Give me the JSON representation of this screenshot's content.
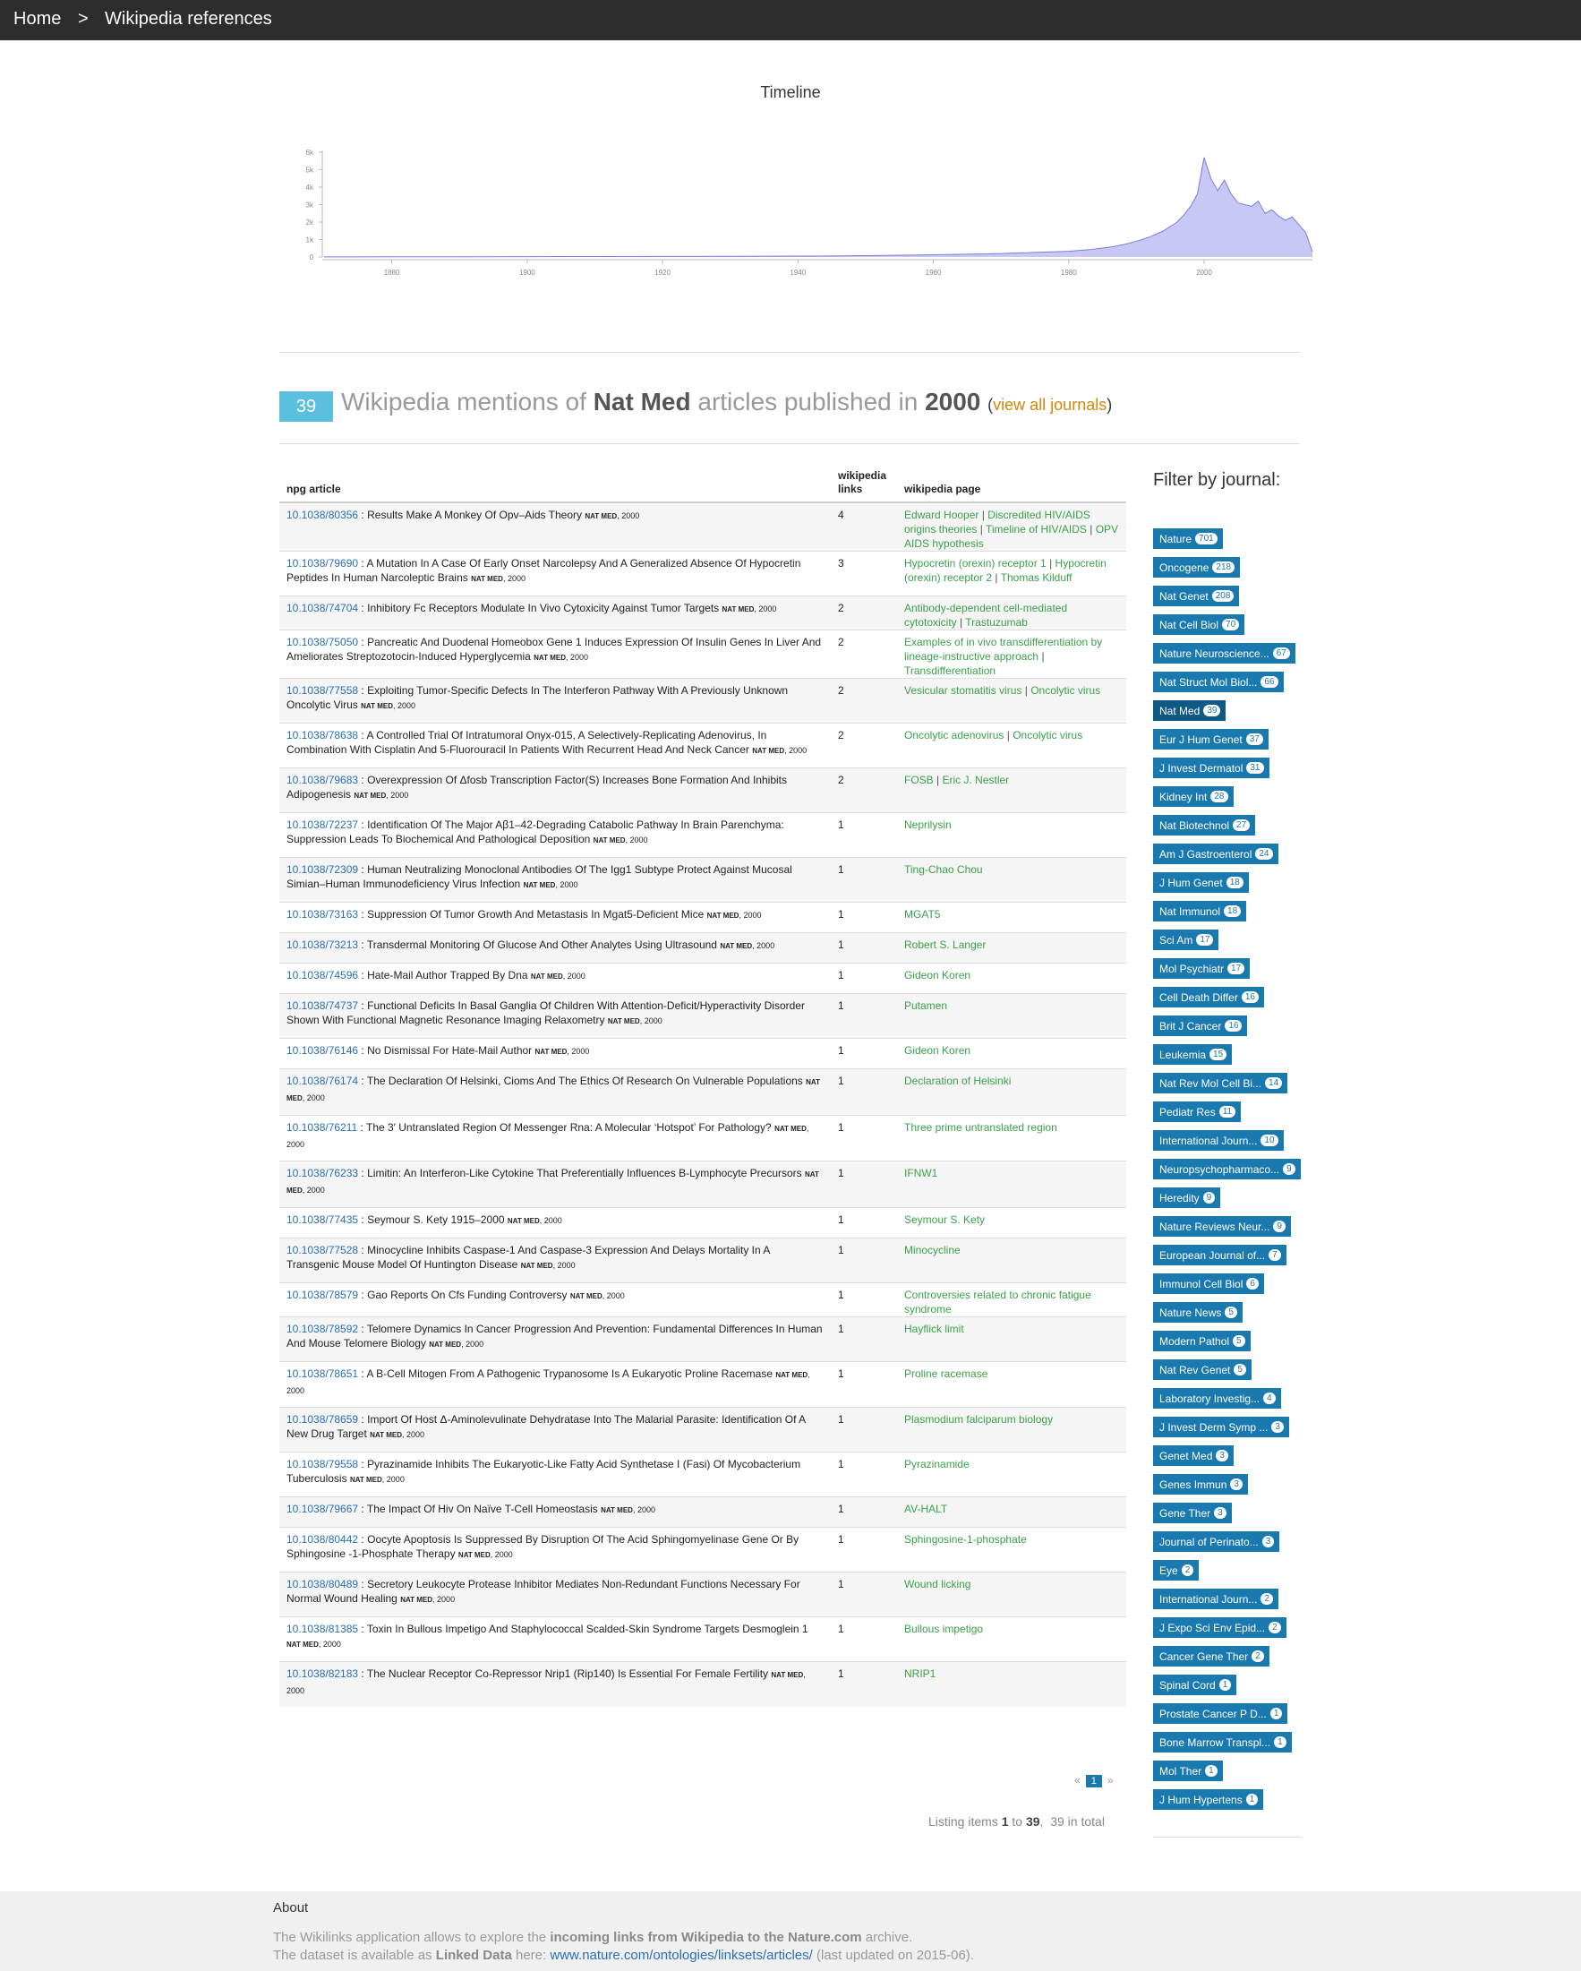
{
  "breadcrumb": {
    "home": "Home",
    "separator": ">",
    "current": "Wikipedia references"
  },
  "timeline": {
    "title": "Timeline"
  },
  "chart_data": {
    "type": "area",
    "title": "Timeline",
    "xlabel": "",
    "ylabel": "",
    "xlim": [
      1870,
      2016
    ],
    "ylim": [
      0,
      6000
    ],
    "y_ticks": [
      "0",
      "1k",
      "2k",
      "3k",
      "4k",
      "5k",
      "6k"
    ],
    "x_ticks": [
      "1880",
      "1900",
      "1920",
      "1940",
      "1960",
      "1980",
      "2000"
    ],
    "colors": {
      "fill": "#c8c8f5",
      "stroke": "#7b7be0"
    },
    "series": [
      {
        "x": [
          1870,
          1880,
          1890,
          1900,
          1910,
          1920,
          1930,
          1940,
          1945,
          1950,
          1955,
          1960,
          1965,
          1970,
          1975,
          1980,
          1983,
          1986,
          1988,
          1990,
          1992,
          1994,
          1996,
          1997,
          1998,
          1999,
          2000,
          2001,
          2002,
          2003,
          2004,
          2005,
          2006,
          2007,
          2008,
          2009,
          2010,
          2011,
          2012,
          2013,
          2014,
          2015,
          2016
        ],
        "y": [
          5,
          10,
          15,
          20,
          25,
          30,
          40,
          50,
          60,
          80,
          100,
          130,
          160,
          200,
          260,
          330,
          420,
          560,
          700,
          900,
          1150,
          1500,
          2000,
          2400,
          2900,
          3600,
          5700,
          4500,
          3800,
          4400,
          3600,
          3100,
          3000,
          2900,
          3200,
          2500,
          2700,
          2350,
          2100,
          2300,
          1850,
          1400,
          300
        ]
      }
    ]
  },
  "heading": {
    "count": "39",
    "prefix": "Wikipedia mentions of",
    "journal": "Nat Med",
    "middle": "articles published in",
    "year": "2000",
    "open": "(",
    "link": "view all journals",
    "close": ")"
  },
  "table": {
    "headers": {
      "article": "npg article",
      "links_line1": "wikipedia",
      "links_line2": "links",
      "page": "wikipedia page"
    },
    "rows": [
      {
        "doi": "10.1038/80356",
        "title": "Results Make A Monkey Of Opv–Aids Theory",
        "journal": "NAT MED",
        "year": ", 2000",
        "links": "4",
        "pages": [
          "Edward Hooper",
          "Discredited HIV/AIDS origins theories",
          "Timeline of HIV/AIDS",
          "OPV AIDS hypothesis"
        ]
      },
      {
        "doi": "10.1038/79690",
        "title": "A Mutation In A Case Of Early Onset Narcolepsy And A Generalized Absence Of Hypocretin Peptides In Human Narcoleptic Brains",
        "journal": "NAT MED",
        "year": ", 2000",
        "links": "3",
        "pages": [
          "Hypocretin (orexin) receptor 1",
          "Hypocretin (orexin) receptor 2",
          "Thomas Kilduff"
        ]
      },
      {
        "doi": "10.1038/74704",
        "title": "Inhibitory Fc Receptors Modulate In Vivo Cytoxicity Against Tumor Targets",
        "journal": "NAT MED",
        "year": ", 2000",
        "links": "2",
        "pages": [
          "Antibody-dependent cell-mediated cytotoxicity",
          "Trastuzumab"
        ]
      },
      {
        "doi": "10.1038/75050",
        "title": "Pancreatic And Duodenal Homeobox Gene 1 Induces Expression Of Insulin Genes In Liver And Ameliorates Streptozotocin-Induced Hyperglycemia",
        "journal": "NAT MED",
        "year": ", 2000",
        "links": "2",
        "pages": [
          "Examples of in vivo transdifferentiation by lineage-instructive approach",
          "Transdifferentiation"
        ]
      },
      {
        "doi": "10.1038/77558",
        "title": "Exploiting Tumor-Specific Defects In The Interferon Pathway With A Previously Unknown Oncolytic Virus",
        "journal": "NAT MED",
        "year": ", 2000",
        "links": "2",
        "pages": [
          "Vesicular stomatitis virus",
          "Oncolytic virus"
        ]
      },
      {
        "doi": "10.1038/78638",
        "title": "A Controlled Trial Of Intratumoral Onyx-015, A Selectively-Replicating Adenovirus, In Combination With Cisplatin And 5-Fluorouracil In Patients With Recurrent Head And Neck Cancer",
        "journal": "NAT MED",
        "year": ", 2000",
        "links": "2",
        "pages": [
          "Oncolytic adenovirus",
          "Oncolytic virus"
        ]
      },
      {
        "doi": "10.1038/79683",
        "title": "Overexpression Of Δfosb Transcription Factor(S) Increases Bone Formation And Inhibits Adipogenesis",
        "journal": "NAT MED",
        "year": ", 2000",
        "links": "2",
        "pages": [
          "FOSB",
          "Eric J. Nestler"
        ]
      },
      {
        "doi": "10.1038/72237",
        "title": "Identification Of The Major Aβ1–42-Degrading Catabolic Pathway In Brain Parenchyma: Suppression Leads To Biochemical And Pathological Deposition",
        "journal": "NAT MED",
        "year": ", 2000",
        "links": "1",
        "pages": [
          "Neprilysin"
        ]
      },
      {
        "doi": "10.1038/72309",
        "title": "Human Neutralizing Monoclonal Antibodies Of The Igg1 Subtype Protect Against Mucosal Simian–Human Immunodeficiency Virus Infection",
        "journal": "NAT MED",
        "year": ", 2000",
        "links": "1",
        "pages": [
          "Ting-Chao Chou"
        ]
      },
      {
        "doi": "10.1038/73163",
        "title": "Suppression Of Tumor Growth And Metastasis In Mgat5-Deficient Mice",
        "journal": "NAT MED",
        "year": ", 2000",
        "links": "1",
        "pages": [
          "MGAT5"
        ]
      },
      {
        "doi": "10.1038/73213",
        "title": "Transdermal Monitoring Of Glucose And Other Analytes Using Ultrasound",
        "journal": "NAT MED",
        "year": ", 2000",
        "links": "1",
        "pages": [
          "Robert S. Langer"
        ]
      },
      {
        "doi": "10.1038/74596",
        "title": "Hate-Mail Author Trapped By Dna",
        "journal": "NAT MED",
        "year": ", 2000",
        "links": "1",
        "pages": [
          "Gideon Koren"
        ]
      },
      {
        "doi": "10.1038/74737",
        "title": "Functional Deficits In Basal Ganglia Of Children With Attention-Deficit/Hyperactivity Disorder Shown With Functional Magnetic Resonance Imaging Relaxometry",
        "journal": "NAT MED",
        "year": ", 2000",
        "links": "1",
        "pages": [
          "Putamen"
        ]
      },
      {
        "doi": "10.1038/76146",
        "title": "No Dismissal For Hate-Mail Author",
        "journal": "NAT MED",
        "year": ", 2000",
        "links": "1",
        "pages": [
          "Gideon Koren"
        ]
      },
      {
        "doi": "10.1038/76174",
        "title": "The Declaration Of Helsinki, Cioms And The Ethics Of Research On Vulnerable Populations",
        "journal": "NAT MED",
        "year": ", 2000",
        "links": "1",
        "pages": [
          "Declaration of Helsinki"
        ]
      },
      {
        "doi": "10.1038/76211",
        "title": "The 3′ Untranslated Region Of Messenger Rna: A Molecular ‘Hotspot’ For Pathology?",
        "journal": "NAT MED",
        "year": ", 2000",
        "links": "1",
        "pages": [
          "Three prime untranslated region"
        ]
      },
      {
        "doi": "10.1038/76233",
        "title": "Limitin: An Interferon-Like Cytokine That Preferentially Influences B-Lymphocyte Precursors",
        "journal": "NAT MED",
        "year": ", 2000",
        "links": "1",
        "pages": [
          "IFNW1"
        ]
      },
      {
        "doi": "10.1038/77435",
        "title": "Seymour S. Kety 1915–2000",
        "journal": "NAT MED",
        "year": ", 2000",
        "links": "1",
        "pages": [
          "Seymour S. Kety"
        ]
      },
      {
        "doi": "10.1038/77528",
        "title": "Minocycline Inhibits Caspase-1 And Caspase-3 Expression And Delays Mortality In A Transgenic Mouse Model Of Huntington Disease",
        "journal": "NAT MED",
        "year": ", 2000",
        "links": "1",
        "pages": [
          "Minocycline"
        ]
      },
      {
        "doi": "10.1038/78579",
        "title": "Gao Reports On Cfs Funding Controversy",
        "journal": "NAT MED",
        "year": ", 2000",
        "links": "1",
        "pages": [
          "Controversies related to chronic fatigue syndrome"
        ]
      },
      {
        "doi": "10.1038/78592",
        "title": "Telomere Dynamics In Cancer Progression And Prevention: Fundamental Differences In Human And Mouse Telomere Biology",
        "journal": "NAT MED",
        "year": ", 2000",
        "links": "1",
        "pages": [
          "Hayflick limit"
        ]
      },
      {
        "doi": "10.1038/78651",
        "title": "A B-Cell Mitogen From A Pathogenic Trypanosome Is A Eukaryotic Proline Racemase",
        "journal": "NAT MED",
        "year": ", 2000",
        "links": "1",
        "pages": [
          "Proline racemase"
        ]
      },
      {
        "doi": "10.1038/78659",
        "title": "Import Of Host Δ-Aminolevulinate Dehydratase Into The Malarial Parasite: Identification Of A New Drug Target",
        "journal": "NAT MED",
        "year": ", 2000",
        "links": "1",
        "pages": [
          "Plasmodium falciparum biology"
        ]
      },
      {
        "doi": "10.1038/79558",
        "title": "Pyrazinamide Inhibits The Eukaryotic-Like Fatty Acid Synthetase I (Fasi) Of Mycobacterium Tuberculosis",
        "journal": "NAT MED",
        "year": ", 2000",
        "links": "1",
        "pages": [
          "Pyrazinamide"
        ]
      },
      {
        "doi": "10.1038/79667",
        "title": "The Impact Of Hiv On Naïve T-Cell Homeostasis",
        "journal": "NAT MED",
        "year": ", 2000",
        "links": "1",
        "pages": [
          "AV-HALT"
        ]
      },
      {
        "doi": "10.1038/80442",
        "title": "Oocyte Apoptosis Is Suppressed By Disruption Of The Acid Sphingomyelinase Gene Or By Sphingosine -1-Phosphate Therapy",
        "journal": "NAT MED",
        "year": ", 2000",
        "links": "1",
        "pages": [
          "Sphingosine-1-phosphate"
        ]
      },
      {
        "doi": "10.1038/80489",
        "title": "Secretory Leukocyte Protease Inhibitor Mediates Non-Redundant Functions Necessary For Normal Wound Healing",
        "journal": "NAT MED",
        "year": ", 2000",
        "links": "1",
        "pages": [
          "Wound licking"
        ]
      },
      {
        "doi": "10.1038/81385",
        "title": "Toxin In Bullous Impetigo And Staphylococcal Scalded-Skin Syndrome Targets Desmoglein 1",
        "journal": "NAT MED",
        "year": ", 2000",
        "links": "1",
        "pages": [
          "Bullous impetigo"
        ]
      },
      {
        "doi": "10.1038/82183",
        "title": "The Nuclear Receptor Co-Repressor Nrip1 (Rip140) Is Essential For Female Fertility",
        "journal": "NAT MED",
        "year": ", 2000",
        "links": "1",
        "pages": [
          "NRIP1"
        ]
      }
    ]
  },
  "filter": {
    "title": "Filter by journal:",
    "journals": [
      {
        "name": "Nature",
        "count": "701"
      },
      {
        "name": "Oncogene",
        "count": "218"
      },
      {
        "name": "Nat Genet",
        "count": "208"
      },
      {
        "name": "Nat Cell Biol",
        "count": "70"
      },
      {
        "name": "Nature Neuroscience...",
        "count": "67"
      },
      {
        "name": "Nat Struct Mol Biol...",
        "count": "66"
      },
      {
        "name": "Nat Med",
        "count": "39",
        "active": true
      },
      {
        "name": "Eur J Hum Genet",
        "count": "37"
      },
      {
        "name": "J Invest Dermatol",
        "count": "31"
      },
      {
        "name": "Kidney Int",
        "count": "28"
      },
      {
        "name": "Nat Biotechnol",
        "count": "27"
      },
      {
        "name": "Am J Gastroenterol",
        "count": "24"
      },
      {
        "name": "J Hum Genet",
        "count": "18"
      },
      {
        "name": "Nat Immunol",
        "count": "18"
      },
      {
        "name": "Sci Am",
        "count": "17"
      },
      {
        "name": "Mol Psychiatr",
        "count": "17"
      },
      {
        "name": "Cell Death Differ",
        "count": "16"
      },
      {
        "name": "Brit J Cancer",
        "count": "16"
      },
      {
        "name": "Leukemia",
        "count": "15"
      },
      {
        "name": "Nat Rev Mol Cell Bi...",
        "count": "14"
      },
      {
        "name": "Pediatr Res",
        "count": "11"
      },
      {
        "name": "International Journ...",
        "count": "10"
      },
      {
        "name": "Neuropsychopharmaco...",
        "count": "9"
      },
      {
        "name": "Heredity",
        "count": "9"
      },
      {
        "name": "Nature Reviews Neur...",
        "count": "9"
      },
      {
        "name": "European Journal of...",
        "count": "7"
      },
      {
        "name": "Immunol Cell Biol",
        "count": "6"
      },
      {
        "name": "Nature News",
        "count": "5"
      },
      {
        "name": "Modern Pathol",
        "count": "5"
      },
      {
        "name": "Nat Rev Genet",
        "count": "5"
      },
      {
        "name": "Laboratory Investig...",
        "count": "4"
      },
      {
        "name": "J Invest Derm Symp ...",
        "count": "3"
      },
      {
        "name": "Genet Med",
        "count": "3"
      },
      {
        "name": "Genes Immun",
        "count": "3"
      },
      {
        "name": "Gene Ther",
        "count": "3"
      },
      {
        "name": "Journal of Perinato...",
        "count": "3"
      },
      {
        "name": "Eye",
        "count": "2"
      },
      {
        "name": "International Journ...",
        "count": "2"
      },
      {
        "name": "J Expo Sci Env Epid...",
        "count": "2"
      },
      {
        "name": "Cancer Gene Ther",
        "count": "2"
      },
      {
        "name": "Spinal Cord",
        "count": "1"
      },
      {
        "name": "Prostate Cancer P D...",
        "count": "1"
      },
      {
        "name": "Bone Marrow Transpl...",
        "count": "1"
      },
      {
        "name": "Mol Ther",
        "count": "1"
      },
      {
        "name": "J Hum Hypertens",
        "count": "1"
      }
    ]
  },
  "pagination": {
    "prev": "«",
    "current": "1",
    "next": "»"
  },
  "listing": {
    "prefix": "Listing items",
    "from": "1",
    "to_word": "to",
    "to": "39",
    "total": "39 in total"
  },
  "footer": {
    "title": "About",
    "line1_a": "The Wikilinks application allows to explore the",
    "line1_b": "incoming links from Wikipedia to the Nature.com",
    "line1_c": "archive.",
    "line2_a": "The dataset is available as",
    "line2_b": "Linked Data",
    "line2_c": "here:",
    "line2_link": "www.nature.com/ontologies/linksets/articles/",
    "line2_d": "(last updated on 2015-06)."
  }
}
